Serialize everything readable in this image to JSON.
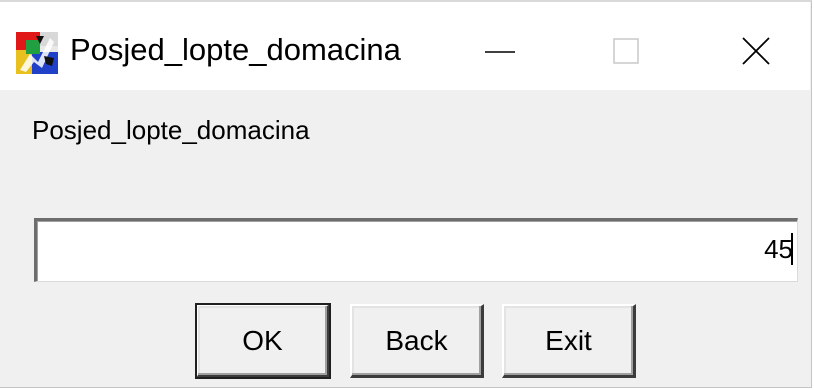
{
  "window": {
    "title": "Posjed_lopte_domacina",
    "icon": "app-logo-icon",
    "controls": {
      "minimize_icon": "minimize-icon",
      "maximize_icon": "maximize-icon",
      "close_icon": "close-icon"
    }
  },
  "prompt": {
    "label": "Posjed_lopte_domacina"
  },
  "input": {
    "value": "45"
  },
  "buttons": {
    "ok_label": "OK",
    "back_label": "Back",
    "exit_label": "Exit"
  },
  "colors": {
    "window_bg": "#f0f0f0",
    "titlebar_bg": "#ffffff",
    "input_bg": "#ffffff"
  }
}
